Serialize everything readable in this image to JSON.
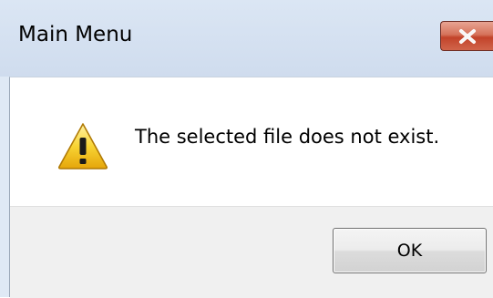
{
  "window": {
    "title": "Main Menu",
    "close_icon": "close-icon"
  },
  "message": {
    "icon": "warning-icon",
    "text": "The selected file does not exist."
  },
  "buttons": {
    "ok_label": "OK"
  },
  "colors": {
    "titlebar": "#dbe6f4",
    "close_button": "#c2432a",
    "warning_fill": "#f5c518",
    "button_area": "#f0f0f0"
  }
}
